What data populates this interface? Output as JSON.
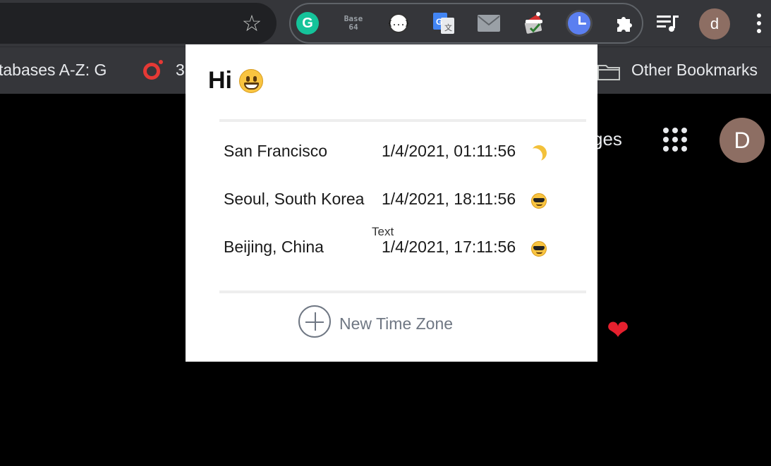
{
  "toolbar": {
    "extensions": [
      {
        "name": "grammarly-extension",
        "icon": "grammarly-icon",
        "glyph": "G"
      },
      {
        "name": "base64-extension",
        "icon": "base64-icon",
        "line1": "Base",
        "line2": "64"
      },
      {
        "name": "json-formatter-extension",
        "icon": "json-braces-icon",
        "glyph": "{...}"
      },
      {
        "name": "google-translate-extension",
        "icon": "translate-icon"
      },
      {
        "name": "mail-extension",
        "icon": "envelope-icon"
      },
      {
        "name": "christmas-extension",
        "icon": "santa-hat-icon"
      },
      {
        "name": "time-zone-extension",
        "icon": "clock-icon",
        "active": true
      }
    ],
    "profile_initial": "d"
  },
  "bookmarks": {
    "item1": "tabases A-Z: G",
    "item2": "3",
    "other": "Other Bookmarks"
  },
  "page": {
    "partial_text": "ges",
    "avatar_initial": "D"
  },
  "popup": {
    "greeting": "Hi",
    "tooltip": "Text",
    "timezones": [
      {
        "city": "San Francisco",
        "time": "1/4/2021, 01:11:56",
        "emoji": "moon"
      },
      {
        "city": "Seoul, South Korea",
        "time": "1/4/2021, 18:11:56",
        "emoji": "sunglasses-face"
      },
      {
        "city": "Beijing, China",
        "time": "1/4/2021, 17:11:56",
        "emoji": "sunglasses-face"
      }
    ],
    "add_label": "New Time Zone"
  },
  "colors": {
    "toolbar_bg": "#35363a",
    "omnibox_bg": "#202124",
    "clock_accent": "#5b7ff0",
    "avatar": "#8d6e63",
    "muted_text": "#6f7783"
  }
}
